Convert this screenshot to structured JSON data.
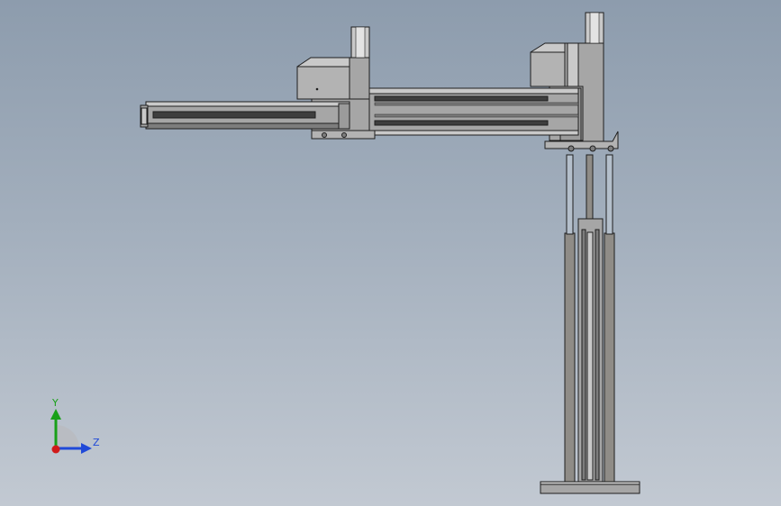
{
  "viewport": {
    "background_top": "#8d9cad",
    "background_bottom": "#c2c9d2"
  },
  "model": {
    "part_fill": "#a6a6a6",
    "part_fill_light": "#c9c9c9",
    "part_fill_dark": "#7d7d7d",
    "outline": "#1e1e1e",
    "slot": "#3e3e3e",
    "rod_fill": "#8f8c87",
    "guide_fill": "#b4bfcb"
  },
  "triad": {
    "y_label": "Y",
    "z_label": "Z",
    "y_color": "#18a018",
    "z_color": "#1f49d8",
    "x_color": "#d01a1a",
    "icons": [
      "y-axis-arrow-icon",
      "z-axis-arrow-icon",
      "x-axis-origin-icon"
    ]
  }
}
